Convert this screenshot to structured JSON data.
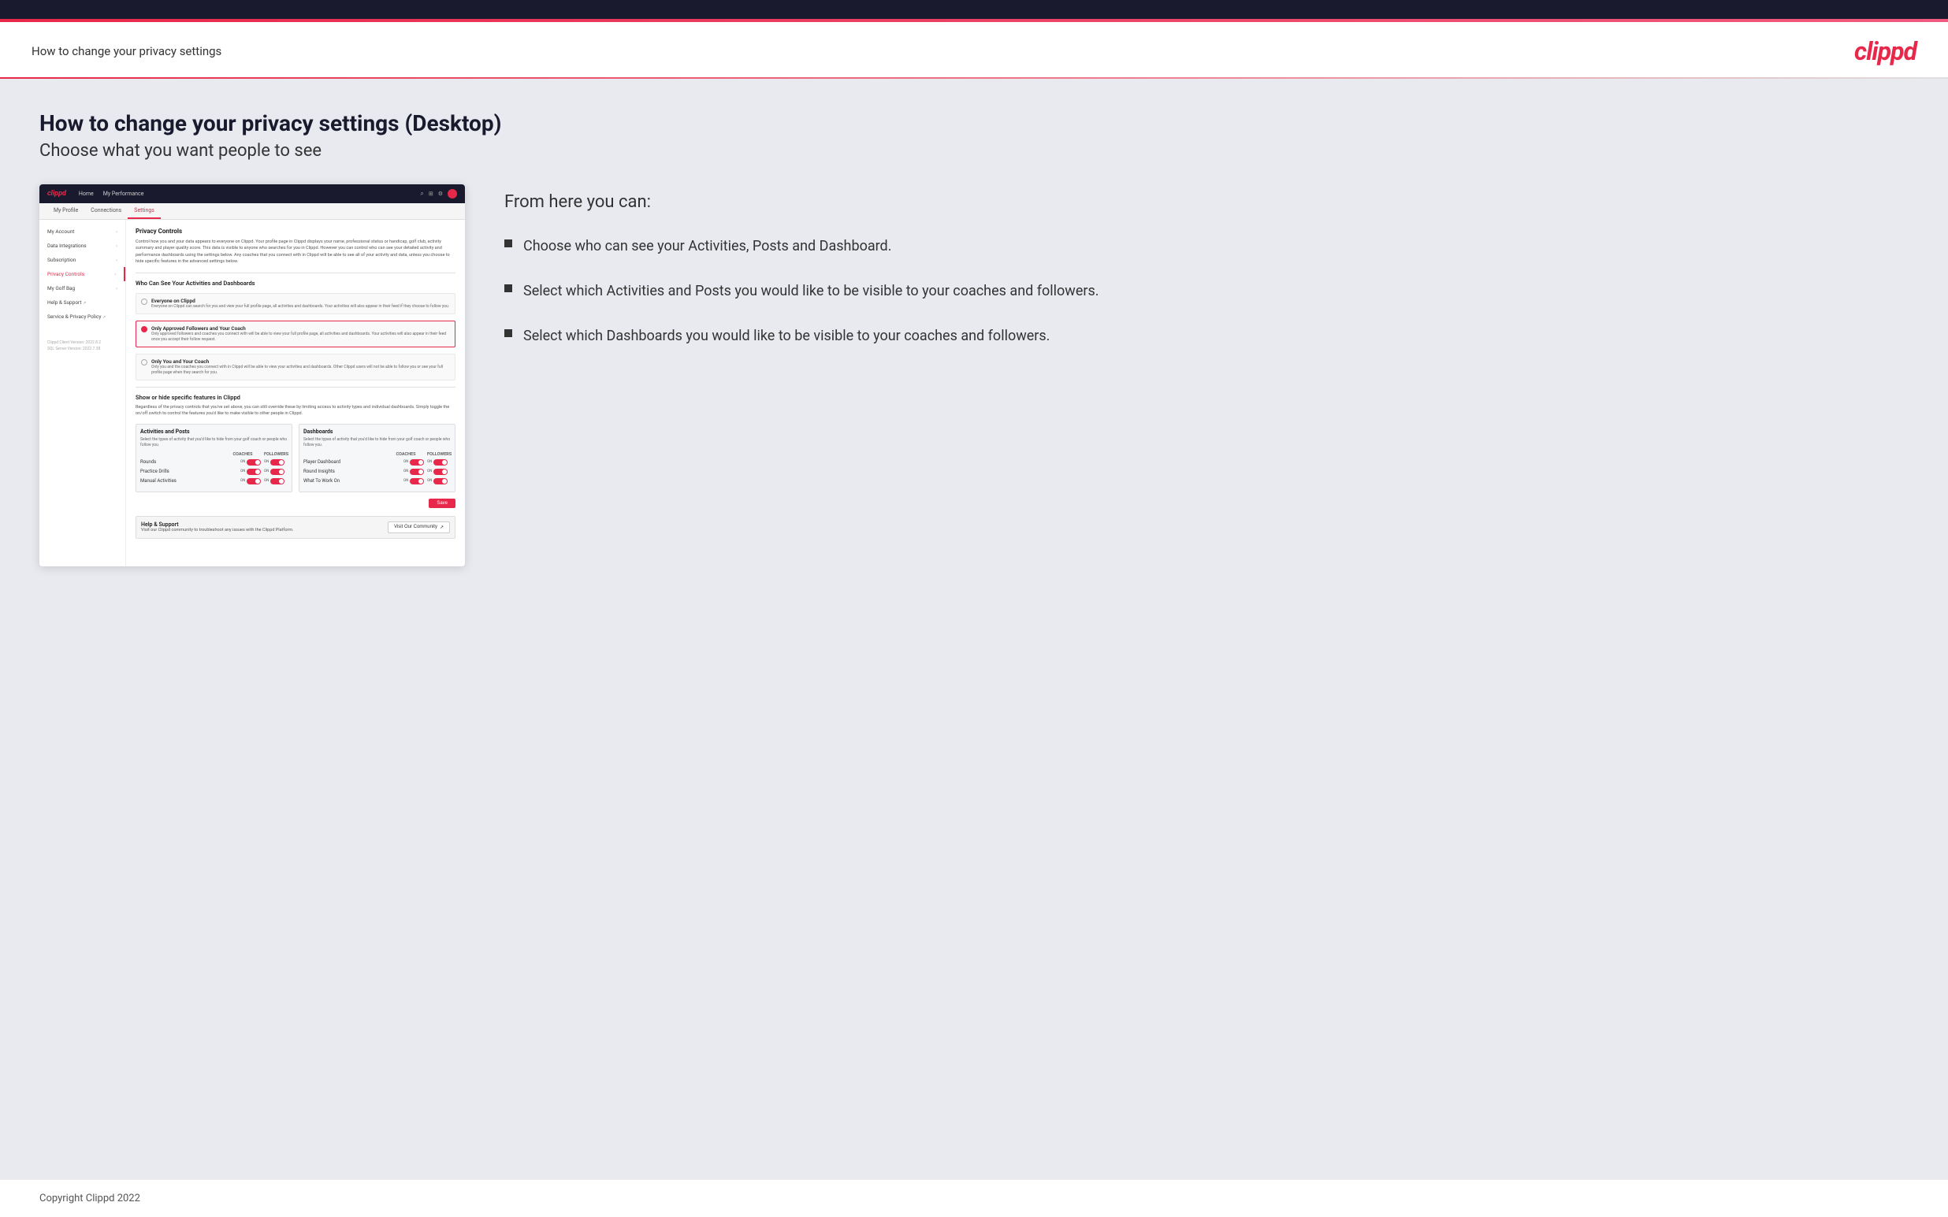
{
  "top_bar": {},
  "header": {
    "title": "How to change your privacy settings",
    "logo": "clippd"
  },
  "main": {
    "page_heading": "How to change your privacy settings (Desktop)",
    "page_subheading": "Choose what you want people to see",
    "right_panel": {
      "from_here_title": "From here you can:",
      "bullets": [
        {
          "text": "Choose who can see your Activities, Posts and Dashboard."
        },
        {
          "text": "Select which Activities and Posts you would like to be visible to your coaches and followers."
        },
        {
          "text": "Select which Dashboards you would like to be visible to your coaches and followers."
        }
      ]
    }
  },
  "mockup": {
    "nav": {
      "logo": "clippd",
      "links": [
        "Home",
        "My Performance"
      ],
      "icons": [
        "search",
        "grid",
        "settings",
        "profile"
      ]
    },
    "tabs": [
      {
        "label": "My Profile",
        "active": false
      },
      {
        "label": "Connections",
        "active": false
      },
      {
        "label": "Settings",
        "active": true
      }
    ],
    "sidebar": {
      "items": [
        {
          "label": "My Account",
          "active": false,
          "arrow": true
        },
        {
          "label": "Data Integrations",
          "active": false,
          "arrow": true
        },
        {
          "label": "Subscription",
          "active": false,
          "arrow": true
        },
        {
          "label": "Privacy Controls",
          "active": true,
          "arrow": true
        },
        {
          "label": "My Golf Bag",
          "active": false,
          "arrow": true
        },
        {
          "label": "Help & Support",
          "active": false,
          "external": true
        },
        {
          "label": "Service & Privacy Policy",
          "active": false,
          "external": true
        }
      ],
      "version": "Clippd Client Version: 2022.8.2\nSQL Server Version: 2022.7.38"
    },
    "privacy_controls": {
      "section_title": "Privacy Controls",
      "section_desc": "Control how you and your data appears to everyone on Clippd. Your profile page in Clippd displays your name, professional status or handicap, golf club, activity summary and player quality score. This data is visible to anyone who searches for you in Clippd. However you can control who can see your detailed activity and performance dashboards using the settings below. Any coaches that you connect with in Clippd will be able to see all of your activity and data, unless you choose to hide specific features in the advanced settings below.",
      "who_section_title": "Who Can See Your Activities and Dashboards",
      "radio_options": [
        {
          "id": "everyone",
          "label": "Everyone on Clippd",
          "desc": "Everyone on Clippd can search for you and view your full profile page, all activities and dashboards. Your activities will also appear in their feed if they choose to follow you.",
          "selected": false
        },
        {
          "id": "followers",
          "label": "Only Approved Followers and Your Coach",
          "desc": "Only approved followers and coaches you connect with will be able to view your full profile page, all activities and dashboards. Your activities will also appear in their feed once you accept their follow request.",
          "selected": true
        },
        {
          "id": "coach_only",
          "label": "Only You and Your Coach",
          "desc": "Only you and the coaches you connect with in Clippd will be able to view your activities and dashboards. Other Clippd users will not be able to follow you or see your full profile page when they search for you.",
          "selected": false
        }
      ],
      "show_hide_title": "Show or hide specific features in Clippd",
      "show_hide_desc": "Regardless of the privacy controls that you've set above, you can still override these by limiting access to activity types and individual dashboards. Simply toggle the on/off switch to control the features you'd like to make visible to other people in Clippd.",
      "activities_panel": {
        "title": "Activities and Posts",
        "desc": "Select the types of activity that you'd like to hide from your golf coach or people who follow you.",
        "columns": [
          "COACHES",
          "FOLLOWERS"
        ],
        "rows": [
          {
            "label": "Rounds",
            "coaches_on": true,
            "followers_on": true
          },
          {
            "label": "Practice Drills",
            "coaches_on": true,
            "followers_on": true
          },
          {
            "label": "Manual Activities",
            "coaches_on": true,
            "followers_on": true
          }
        ]
      },
      "dashboards_panel": {
        "title": "Dashboards",
        "desc": "Select the types of activity that you'd like to hide from your golf coach or people who follow you.",
        "columns": [
          "COACHES",
          "FOLLOWERS"
        ],
        "rows": [
          {
            "label": "Player Dashboard",
            "coaches_on": true,
            "followers_on": true
          },
          {
            "label": "Round Insights",
            "coaches_on": true,
            "followers_on": true
          },
          {
            "label": "What To Work On",
            "coaches_on": true,
            "followers_on": true
          }
        ]
      },
      "save_label": "Save"
    },
    "help": {
      "title": "Help & Support",
      "desc": "Visit our Clippd community to troubleshoot any issues with the Clippd Platform.",
      "button": "Visit Our Community"
    }
  },
  "footer": {
    "copyright": "Copyright Clippd 2022"
  }
}
